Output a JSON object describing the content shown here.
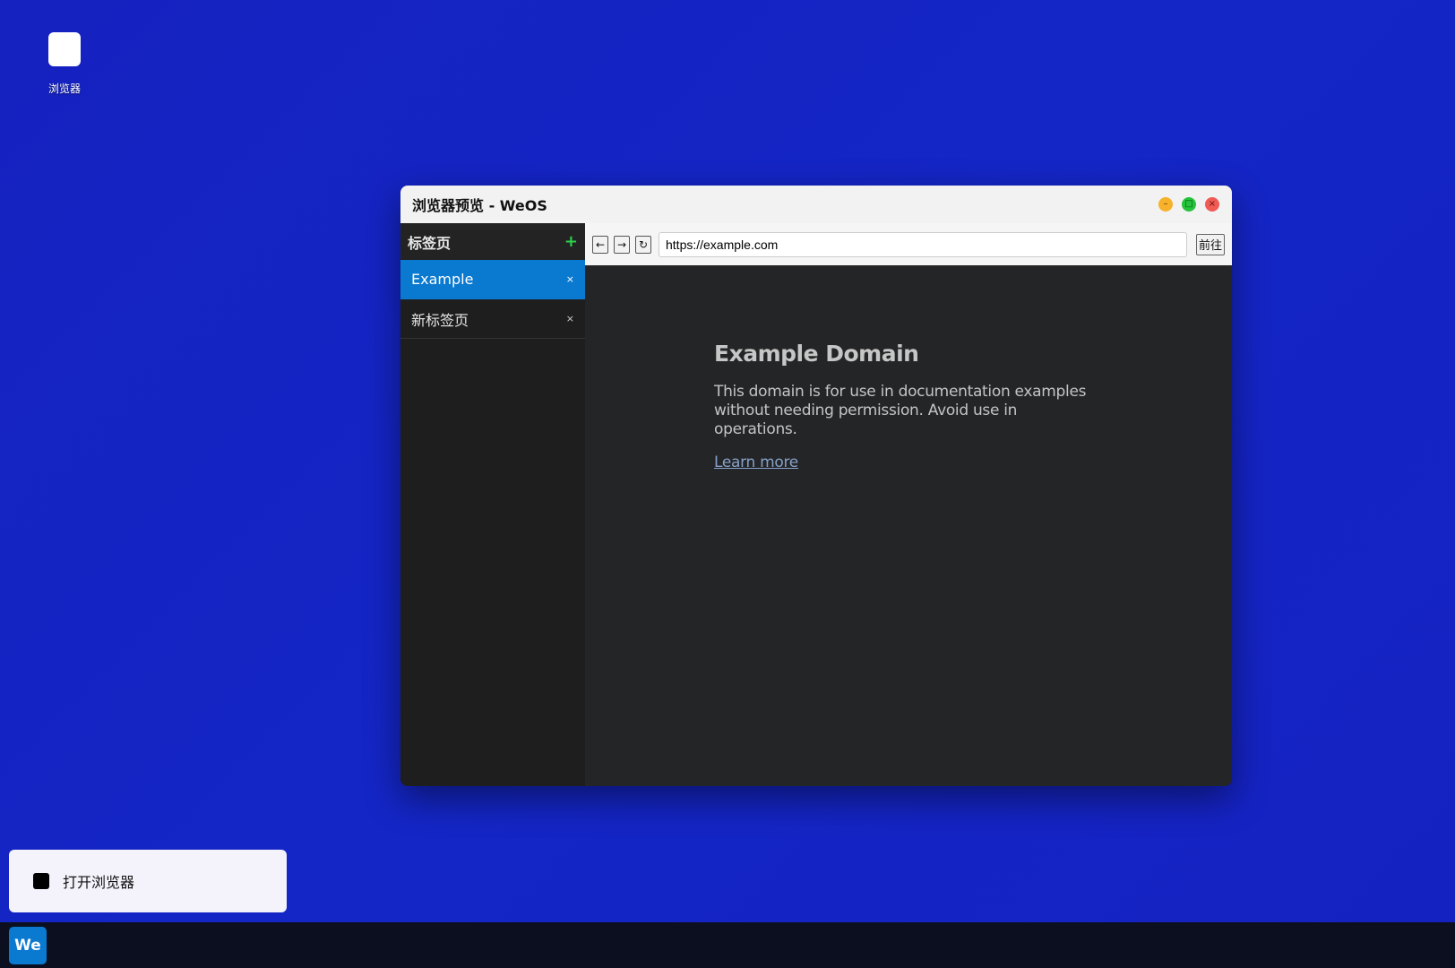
{
  "desktop": {
    "icons": [
      {
        "label": "浏览器",
        "icon": "browser-icon"
      }
    ]
  },
  "window": {
    "title": "浏览器预览 - WeOS",
    "controls": {
      "minimize": "–",
      "maximize": "□",
      "close": "×"
    }
  },
  "sidebar": {
    "header": "标签页",
    "add_label": "+",
    "tabs": [
      {
        "label": "Example",
        "close": "×",
        "active": true
      },
      {
        "label": "新标签页",
        "close": "×",
        "active": false
      }
    ]
  },
  "toolbar": {
    "back_label": "←",
    "forward_label": "→",
    "reload_label": "↻",
    "url": "https://example.com",
    "go_label": "前往"
  },
  "page": {
    "heading": "Example Domain",
    "body": "This domain is for use in documentation examples without needing permission. Avoid use in operations.",
    "link": "Learn more"
  },
  "notification": {
    "text": "打开浏览器"
  },
  "taskbar": {
    "start_label": "We"
  },
  "colors": {
    "desktop_bg": "#1522c0",
    "accent": "#0a79d0",
    "minimize": "#f7b12b",
    "maximize": "#24c43a",
    "close": "#f05b54",
    "add": "#2bd34b"
  }
}
